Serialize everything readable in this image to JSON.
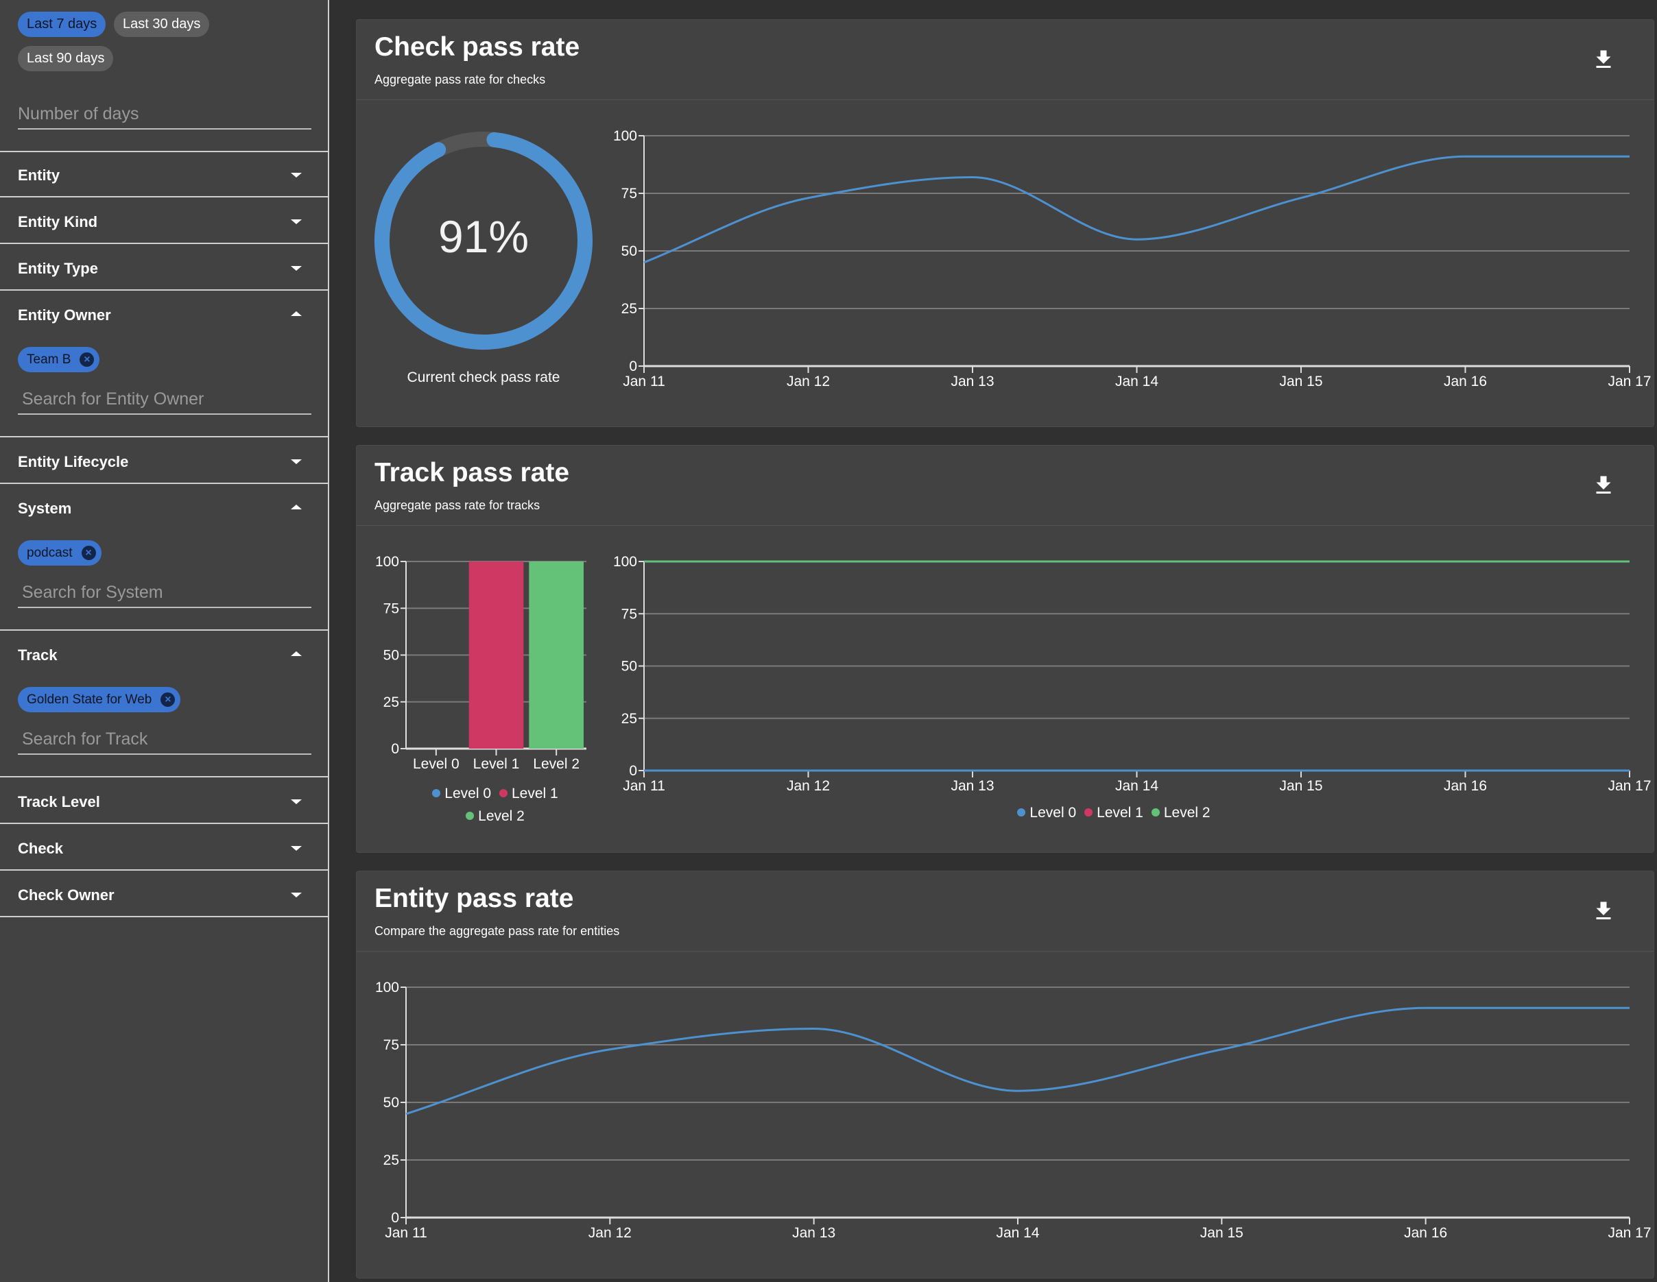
{
  "sidebar": {
    "date_chips": [
      {
        "label": "Last 7 days",
        "active": true
      },
      {
        "label": "Last 30 days",
        "active": false
      },
      {
        "label": "Last 90 days",
        "active": false
      }
    ],
    "number_of_days_placeholder": "Number of days",
    "filters": [
      {
        "label": "Entity",
        "expanded": false
      },
      {
        "label": "Entity Kind",
        "expanded": false
      },
      {
        "label": "Entity Type",
        "expanded": false
      },
      {
        "label": "Entity Owner",
        "expanded": true,
        "chip": "Team B",
        "search_placeholder": "Search for Entity Owner"
      },
      {
        "label": "Entity Lifecycle",
        "expanded": false
      },
      {
        "label": "System",
        "expanded": true,
        "chip": "podcast",
        "search_placeholder": "Search for System"
      },
      {
        "label": "Track",
        "expanded": true,
        "chip": "Golden State for Web",
        "search_placeholder": "Search for Track"
      },
      {
        "label": "Track Level",
        "expanded": false
      },
      {
        "label": "Check",
        "expanded": false
      },
      {
        "label": "Check Owner",
        "expanded": false
      }
    ]
  },
  "cards": {
    "check": {
      "title": "Check pass rate",
      "subtitle": "Aggregate pass rate for checks",
      "gauge": {
        "value": 91,
        "display": "91%",
        "label": "Current check pass rate",
        "color": "#4e91d0"
      },
      "download_icon": "download-icon"
    },
    "track": {
      "title": "Track pass rate",
      "subtitle": "Aggregate pass rate for tracks",
      "download_icon": "download-icon"
    },
    "entity": {
      "title": "Entity pass rate",
      "subtitle": "Compare the aggregate pass rate for entities",
      "download_icon": "download-icon"
    }
  },
  "chart_data": [
    {
      "type": "line",
      "categories": [
        "Jan 11",
        "Jan 12",
        "Jan 13",
        "Jan 14",
        "Jan 15",
        "Jan 16",
        "Jan 17"
      ],
      "series": [
        {
          "values": [
            45,
            73,
            82,
            55,
            73,
            91,
            91
          ],
          "color": "#4e91d0"
        }
      ],
      "yticks": [
        0,
        25,
        50,
        75,
        100
      ],
      "ylim": [
        0,
        100
      ],
      "grid": true
    },
    {
      "type": "bar",
      "categories": [
        "Level 0",
        "Level 1",
        "Level 2"
      ],
      "values": [
        0,
        100,
        100
      ],
      "colors": [
        "#4e91d0",
        "#cf3862",
        "#63c178"
      ],
      "yticks": [
        0,
        25,
        50,
        75,
        100
      ],
      "ylim": [
        0,
        100
      ],
      "grid": true,
      "legend": [
        {
          "name": "Level 0",
          "color": "#4e91d0"
        },
        {
          "name": "Level 1",
          "color": "#cf3862"
        },
        {
          "name": "Level 2",
          "color": "#63c178"
        }
      ],
      "legend_position": "bottom"
    },
    {
      "type": "line",
      "categories": [
        "Jan 11",
        "Jan 12",
        "Jan 13",
        "Jan 14",
        "Jan 15",
        "Jan 16",
        "Jan 17"
      ],
      "series": [
        {
          "name": "Level 0",
          "values": [
            0,
            0,
            0,
            0,
            0,
            0,
            0
          ],
          "color": "#4e91d0"
        },
        {
          "name": "Level 1",
          "values": [
            100,
            100,
            100,
            100,
            100,
            100,
            100
          ],
          "color": "#cf3862"
        },
        {
          "name": "Level 2",
          "values": [
            100,
            100,
            100,
            100,
            100,
            100,
            100
          ],
          "color": "#63c178"
        }
      ],
      "yticks": [
        0,
        25,
        50,
        75,
        100
      ],
      "ylim": [
        0,
        100
      ],
      "grid": true,
      "legend_position": "bottom"
    },
    {
      "type": "line",
      "categories": [
        "Jan 11",
        "Jan 12",
        "Jan 13",
        "Jan 14",
        "Jan 15",
        "Jan 16",
        "Jan 17"
      ],
      "series": [
        {
          "values": [
            45,
            73,
            82,
            55,
            73,
            91,
            91
          ],
          "color": "#4e91d0"
        }
      ],
      "yticks": [
        0,
        25,
        50,
        75,
        100
      ],
      "ylim": [
        0,
        100
      ],
      "grid": true
    }
  ]
}
